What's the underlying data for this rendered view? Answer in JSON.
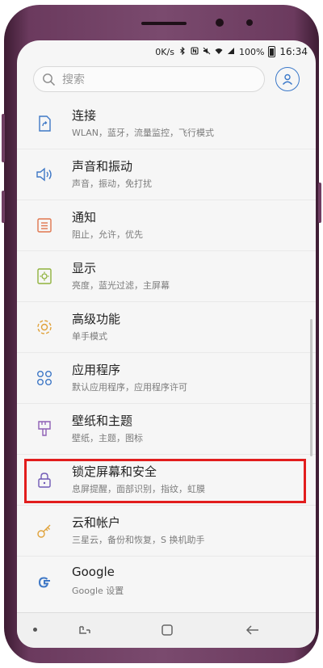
{
  "status_bar": {
    "network_speed": "0K/s",
    "battery_percent": "100%",
    "time": "16:34"
  },
  "search": {
    "placeholder": "搜索"
  },
  "settings_items": [
    {
      "title": "连接",
      "subtitle": "WLAN，蓝牙，流量监控，飞行模式",
      "icon": "connections-icon"
    },
    {
      "title": "声音和振动",
      "subtitle": "声音，振动，免打扰",
      "icon": "sound-icon"
    },
    {
      "title": "通知",
      "subtitle": "阻止，允许，优先",
      "icon": "notifications-icon"
    },
    {
      "title": "显示",
      "subtitle": "亮度，蓝光过滤，主屏幕",
      "icon": "display-icon"
    },
    {
      "title": "高级功能",
      "subtitle": "单手模式",
      "icon": "advanced-features-icon"
    },
    {
      "title": "应用程序",
      "subtitle": "默认应用程序，应用程序许可",
      "icon": "apps-icon"
    },
    {
      "title": "壁纸和主题",
      "subtitle": "壁纸，主题，图标",
      "icon": "wallpaper-brush-icon"
    },
    {
      "title": "锁定屏幕和安全",
      "subtitle": "息屏提醒，面部识别，指纹，虹膜",
      "icon": "lock-icon",
      "highlighted": true
    },
    {
      "title": "云和帐户",
      "subtitle": "三星云，备份和恢复，S 换机助手",
      "icon": "key-icon"
    },
    {
      "title": "Google",
      "subtitle": "Google 设置",
      "icon": "google-icon"
    }
  ],
  "colors": {
    "icon_accent": "#3f78c6",
    "highlight_border": "#e21d1d",
    "phone_frame": "#7a4a6e"
  }
}
